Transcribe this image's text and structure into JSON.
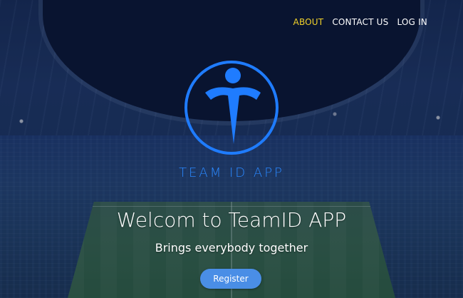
{
  "nav": {
    "items": [
      {
        "label": "ABOUT",
        "active": true
      },
      {
        "label": "CONTACT US",
        "active": false
      },
      {
        "label": "LOG IN",
        "active": false
      }
    ]
  },
  "logo": {
    "icon": "team-id-logo-icon",
    "text": "TEAM ID APP"
  },
  "hero": {
    "title": "Welcom to TeamID APP",
    "subtitle": "Brings everybody together",
    "register_label": "Register"
  },
  "colors": {
    "accent": "#2a88ff",
    "nav_active": "#f2d22a",
    "button": "#4a8ee6"
  }
}
